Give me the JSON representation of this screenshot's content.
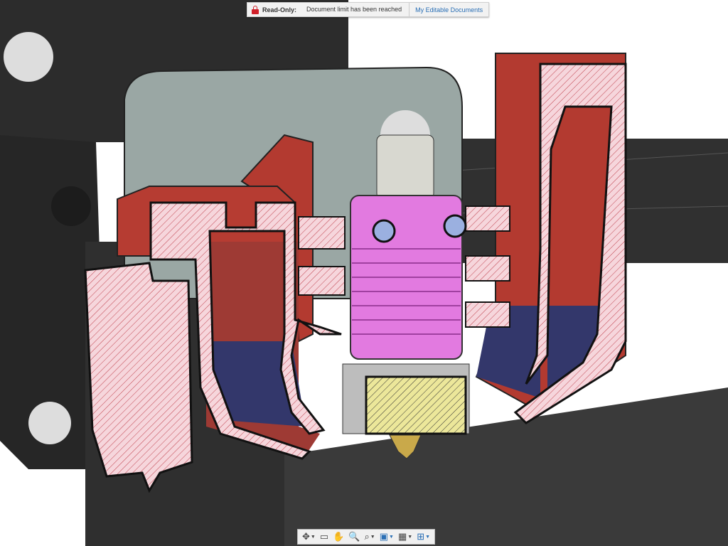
{
  "banner": {
    "status_label": "Read-Only:",
    "message": "Document limit has been reached",
    "link_label": "My Editable Documents",
    "icon": "lock-icon",
    "accent_color": "#d0202a"
  },
  "toolbar": {
    "items": [
      {
        "name": "orbit",
        "icon": "orbit-icon",
        "glyph": "✥",
        "has_dropdown": true
      },
      {
        "name": "look-at",
        "icon": "look-at-icon",
        "glyph": "▭",
        "has_dropdown": false
      },
      {
        "name": "pan",
        "icon": "pan-hand-icon",
        "glyph": "✋",
        "has_dropdown": false
      },
      {
        "name": "zoom",
        "icon": "zoom-icon",
        "glyph": "🔍",
        "has_dropdown": false
      },
      {
        "name": "fit",
        "icon": "zoom-window-icon",
        "glyph": "⌕",
        "has_dropdown": true
      },
      {
        "name": "display-settings",
        "icon": "display-icon",
        "glyph": "▣",
        "has_dropdown": true
      },
      {
        "name": "grid-settings",
        "icon": "grid-icon",
        "glyph": "▦",
        "has_dropdown": true
      },
      {
        "name": "viewports",
        "icon": "viewports-icon",
        "glyph": "⊞",
        "has_dropdown": true
      }
    ]
  }
}
